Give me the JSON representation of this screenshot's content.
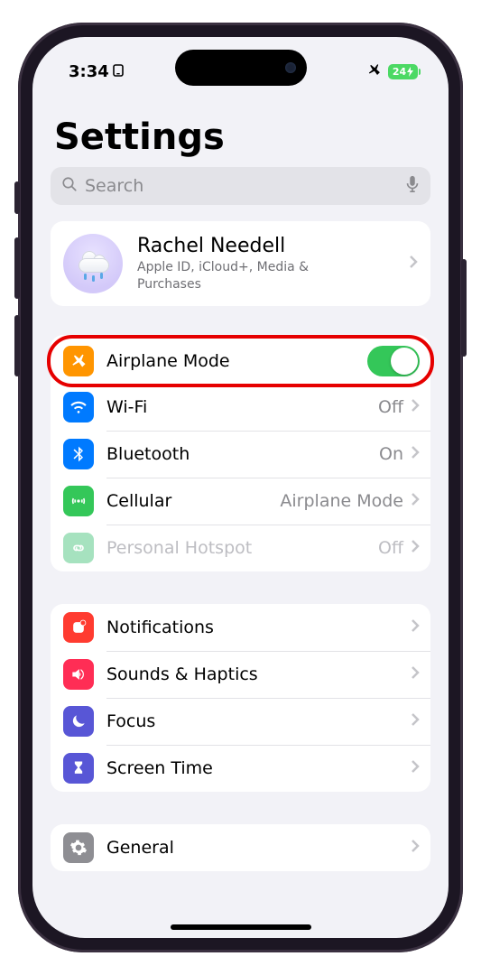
{
  "status": {
    "time": "3:34",
    "airplane_active": true,
    "battery_percent": "24"
  },
  "title": "Settings",
  "search": {
    "placeholder": "Search"
  },
  "account": {
    "name": "Rachel Needell",
    "subtitle": "Apple ID, iCloud+, Media & Purchases"
  },
  "group_connectivity": [
    {
      "icon": "airplane-icon",
      "icon_color": "bg-orange",
      "label": "Airplane Mode",
      "control": "switch",
      "switch_on": true,
      "highlighted": true
    },
    {
      "icon": "wifi-icon",
      "icon_color": "bg-blue",
      "label": "Wi-Fi",
      "control": "value",
      "value": "Off"
    },
    {
      "icon": "bluetooth-icon",
      "icon_color": "bg-blue",
      "label": "Bluetooth",
      "control": "value",
      "value": "On"
    },
    {
      "icon": "cellular-icon",
      "icon_color": "bg-green",
      "label": "Cellular",
      "control": "value",
      "value": "Airplane Mode"
    },
    {
      "icon": "hotspot-icon",
      "icon_color": "bg-emerald",
      "label": "Personal Hotspot",
      "control": "value",
      "value": "Off",
      "dim": true
    }
  ],
  "group_notifications": [
    {
      "icon": "notifications-icon",
      "icon_color": "bg-red",
      "label": "Notifications"
    },
    {
      "icon": "sounds-icon",
      "icon_color": "bg-pink",
      "label": "Sounds & Haptics"
    },
    {
      "icon": "moon-icon",
      "icon_color": "bg-indigo",
      "label": "Focus"
    },
    {
      "icon": "hourglass-icon",
      "icon_color": "bg-indigo",
      "label": "Screen Time"
    }
  ],
  "group_general": [
    {
      "icon": "gear-icon",
      "icon_color": "bg-gray",
      "label": "General"
    }
  ]
}
